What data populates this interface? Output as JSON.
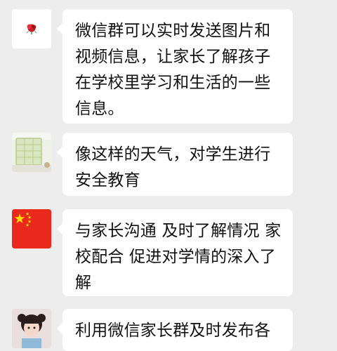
{
  "messages": [
    {
      "avatar": "rose-avatar",
      "text": "微信群可以实时发送图片和视频信息，让家长了解孩子在学校里学习和生活的一些信息。"
    },
    {
      "avatar": "classroom-photo-avatar",
      "text": "像这样的天气，对学生进行安全教育"
    },
    {
      "avatar": "china-flag-avatar",
      "text": "与家长沟通 及时了解情况 家校配合 促进对学情的深入了解"
    },
    {
      "avatar": "child-photo-avatar",
      "text": "利用微信家长群及时发布各"
    }
  ],
  "colors": {
    "background": "#ededed",
    "bubble": "#ffffff",
    "text": "#111111",
    "flag_red": "#e8291c",
    "flag_yellow": "#ffde00"
  }
}
